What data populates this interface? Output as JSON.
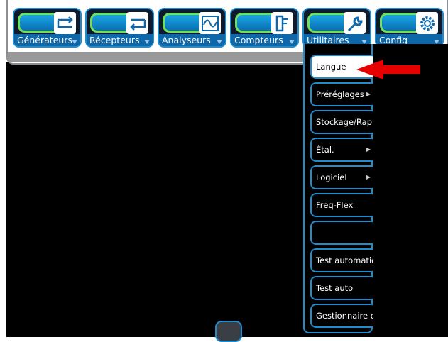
{
  "tabs": [
    {
      "label": "Générateurs",
      "icon": "transfer-right-icon"
    },
    {
      "label": "Récepteurs",
      "icon": "transfer-left-icon"
    },
    {
      "label": "Analyseurs",
      "icon": "waveform-icon"
    },
    {
      "label": "Compteurs",
      "icon": "counter-icon"
    },
    {
      "label": "Utilitaires",
      "icon": "wrench-icon"
    },
    {
      "label": "Config",
      "icon": "gear-icon"
    }
  ],
  "menu": {
    "items": [
      {
        "label": "Langue",
        "selected": true,
        "submenu": false
      },
      {
        "label": "Préréglages",
        "submenu": true
      },
      {
        "label": "Stockage/Rapp",
        "submenu": false
      },
      {
        "label": "Étal.",
        "submenu": true
      },
      {
        "label": "Logiciel",
        "submenu": true
      },
      {
        "label": "Freq-Flex",
        "submenu": false
      },
      {
        "label": "",
        "submenu": false
      },
      {
        "label": "Test automatic",
        "submenu": false
      },
      {
        "label": "Test auto",
        "submenu": false
      },
      {
        "label": "Gestionnaire d",
        "submenu": false
      }
    ]
  },
  "colors": {
    "accent": "#1e8ccf",
    "highlight": "#6fe05c",
    "pointer": "#e60000"
  }
}
